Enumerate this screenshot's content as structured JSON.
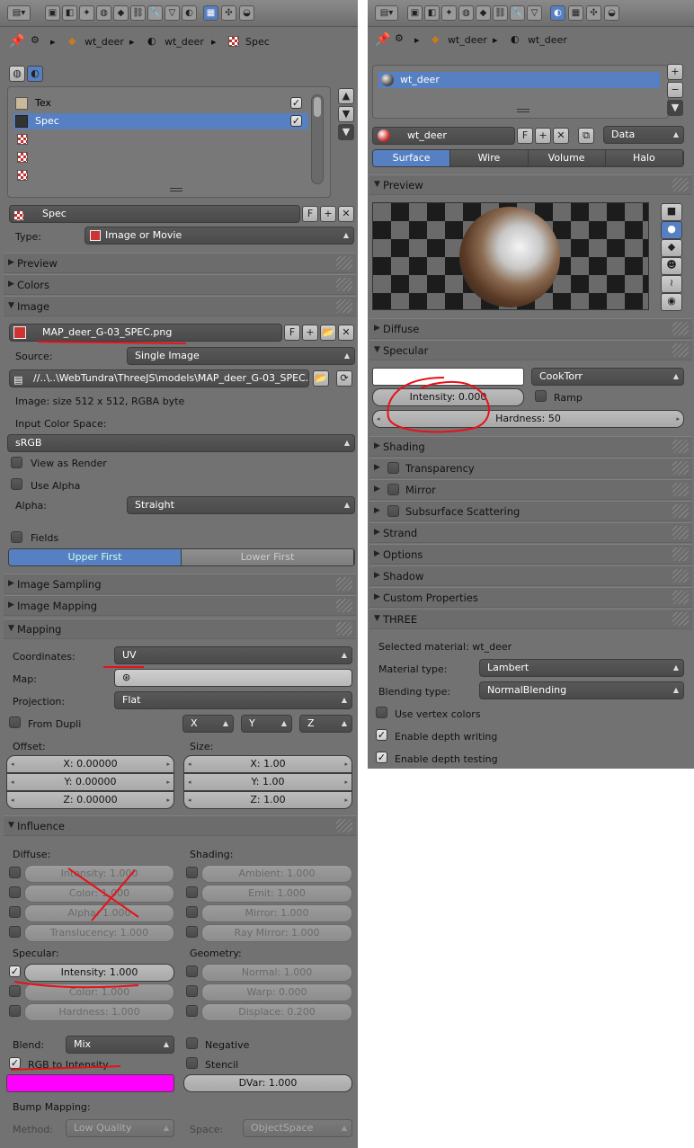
{
  "left": {
    "breadcrumb": {
      "obj": "wt_deer",
      "mat": "wt_deer",
      "tex": "Spec"
    },
    "tex_slots": [
      {
        "name": "Tex",
        "checked": true
      },
      {
        "name": "Spec",
        "checked": true,
        "selected": true
      },
      {
        "name": ""
      },
      {
        "name": ""
      },
      {
        "name": ""
      }
    ],
    "tex_name": "Spec",
    "type_label": "Type:",
    "type_value": "Image or Movie",
    "sections": {
      "preview": "Preview",
      "colors": "Colors",
      "image": "Image",
      "image_sampling": "Image Sampling",
      "image_mapping": "Image Mapping",
      "mapping": "Mapping",
      "influence": "Influence"
    },
    "image": {
      "file": "MAP_deer_G-03_SPEC.png",
      "source_label": "Source:",
      "source": "Single Image",
      "path": "//..\\..\\WebTundra\\ThreeJS\\models\\MAP_deer_G-03_SPEC.png",
      "info": "Image: size 512 x 512, RGBA byte",
      "input_cs_label": "Input Color Space:",
      "input_cs": "sRGB",
      "view_render": "View as Render",
      "use_alpha": "Use Alpha",
      "alpha_label": "Alpha:",
      "alpha": "Straight",
      "fields": "Fields",
      "upper": "Upper First",
      "lower": "Lower First"
    },
    "mapping": {
      "coord_label": "Coordinates:",
      "coord": "UV",
      "map_label": "Map:",
      "proj_label": "Projection:",
      "proj": "Flat",
      "from_dupli": "From Dupli",
      "x": "X",
      "y": "Y",
      "z": "Z",
      "offset_label": "Offset:",
      "size_label": "Size:",
      "offset": [
        "X: 0.00000",
        "Y: 0.00000",
        "Z: 0.00000"
      ],
      "size": [
        "X: 1.00",
        "Y: 1.00",
        "Z: 1.00"
      ]
    },
    "influence": {
      "diffuse_label": "Diffuse:",
      "shading_label": "Shading:",
      "diffuse": [
        "Intensity: 1.000",
        "Color: 1.000",
        "Alpha: 1.000",
        "Translucency: 1.000"
      ],
      "shading": [
        "Ambient: 1.000",
        "Emit: 1.000",
        "Mirror: 1.000",
        "Ray Mirror: 1.000"
      ],
      "specular_label": "Specular:",
      "geometry_label": "Geometry:",
      "specular": [
        "Intensity: 1.000",
        "Color: 1.000",
        "Hardness: 1.000"
      ],
      "geometry": [
        "Normal: 1.000",
        "Warp: 0.000",
        "Displace: 0.200"
      ],
      "blend_label": "Blend:",
      "blend": "Mix",
      "negative": "Negative",
      "rgb_to_int": "RGB to Intensity",
      "stencil": "Stencil",
      "dvar": "DVar: 1.000",
      "magenta": "#ff00ff",
      "bump_label": "Bump Mapping:",
      "method_label": "Method:",
      "method": "Low Quality",
      "space_label": "Space:",
      "space": "ObjectSpace"
    }
  },
  "right": {
    "breadcrumb": {
      "obj": "wt_deer",
      "mat": "wt_deer"
    },
    "slots": [
      "wt_deer"
    ],
    "mat_name": "wt_deer",
    "f": "F",
    "data_value": "Data",
    "tabs": [
      "Surface",
      "Wire",
      "Volume",
      "Halo"
    ],
    "sections": {
      "preview": "Preview",
      "diffuse": "Diffuse",
      "specular": "Specular",
      "shading": "Shading",
      "transparency": "Transparency",
      "mirror": "Mirror",
      "sss": "Subsurface Scattering",
      "strand": "Strand",
      "options": "Options",
      "shadow": "Shadow",
      "custom": "Custom Properties",
      "three": "THREE"
    },
    "specular": {
      "shader": "CookTorr",
      "intensity": "Intensity: 0.000",
      "ramp": "Ramp",
      "hardness": "Hardness: 50",
      "color": "#ffffff"
    },
    "three": {
      "selected": "Selected material: wt_deer",
      "mat_type_label": "Material type:",
      "mat_type": "Lambert",
      "blend_type_label": "Blending type:",
      "blend_type": "NormalBlending",
      "vertex_colors": "Use vertex colors",
      "depth_write": "Enable depth writing",
      "depth_test": "Enable depth testing"
    }
  }
}
